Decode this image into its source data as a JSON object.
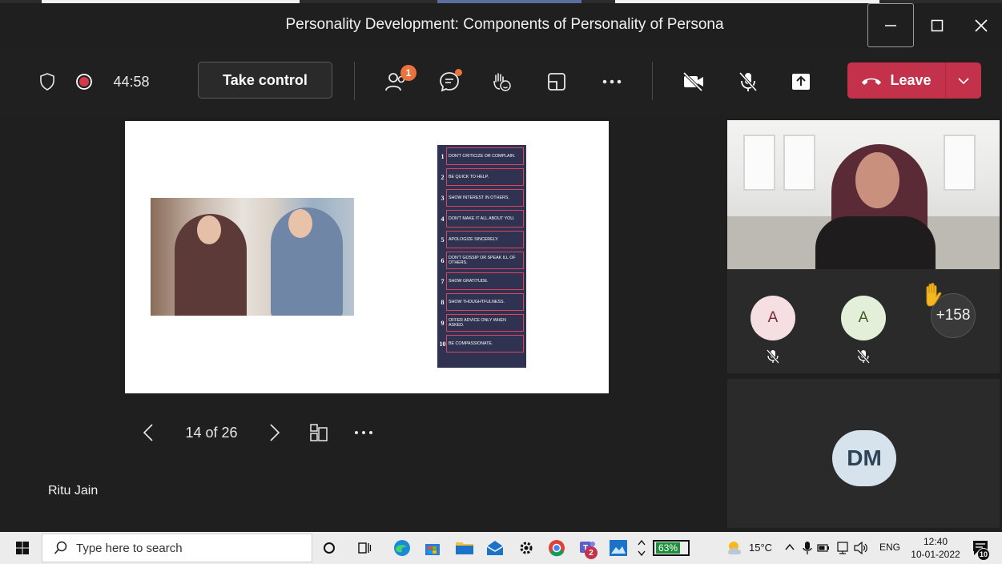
{
  "window": {
    "title": "Personality Development: Components of Personality of Persona"
  },
  "toolbar": {
    "timer": "44:58",
    "take_control": "Take control",
    "participants_badge": "1",
    "leave_label": "Leave"
  },
  "slide": {
    "items": [
      {
        "num": "1",
        "text": "Don't criticize or complain."
      },
      {
        "num": "2",
        "text": "Be quick to help."
      },
      {
        "num": "3",
        "text": "Show interest in others."
      },
      {
        "num": "4",
        "text": "Don't make it all about you."
      },
      {
        "num": "5",
        "text": "Apologize sincerely."
      },
      {
        "num": "6",
        "text": "Don't gossip or speak ill of others."
      },
      {
        "num": "7",
        "text": "Show gratitude."
      },
      {
        "num": "8",
        "text": "Show thoughtfulness."
      },
      {
        "num": "9",
        "text": "Offer advice only when asked."
      },
      {
        "num": "10",
        "text": "Be compassionate."
      }
    ]
  },
  "slide_nav": {
    "page": "14 of 26"
  },
  "presenter": {
    "name": "Ritu Jain"
  },
  "participants": {
    "a1_initial": "A",
    "a2_initial": "A",
    "overflow": "+158",
    "dm_initials": "DM"
  },
  "taskbar": {
    "search_placeholder": "Type here to search",
    "battery": "63%",
    "teams_badge": "2",
    "weather": "15°C",
    "lang": "ENG",
    "time": "12:40",
    "date": "10-01-2022",
    "notifications": "10"
  },
  "colors": {
    "leave": "#c4314b",
    "badge": "#e9723d",
    "slide_list_bg": "#2f3351",
    "slide_list_border": "#d9455f"
  }
}
